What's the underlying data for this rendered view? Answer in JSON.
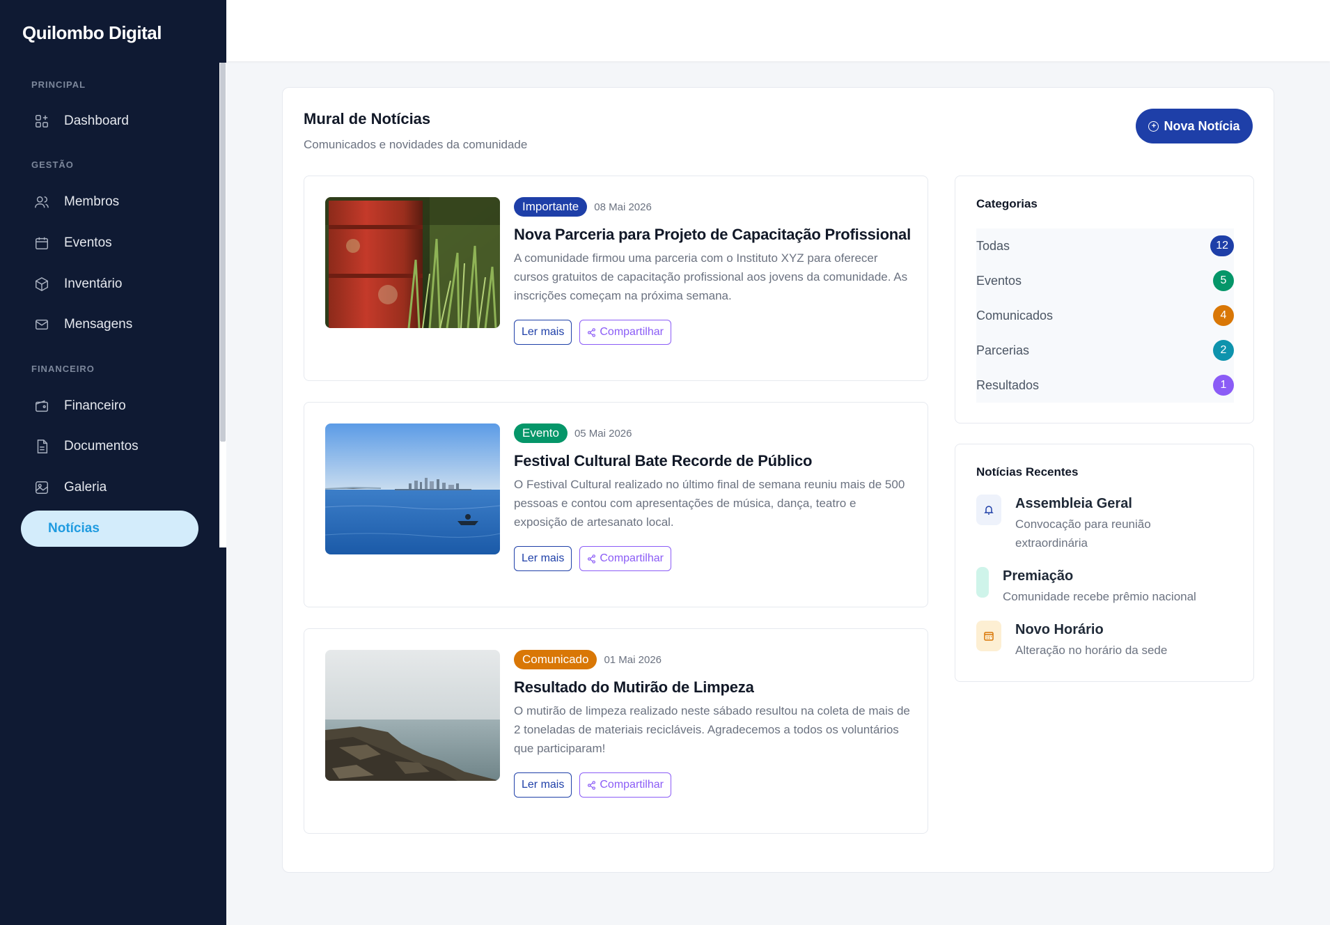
{
  "app": {
    "brand": "Quilombo Digital"
  },
  "sidebar": {
    "sections": [
      {
        "label": "PRINCIPAL"
      },
      {
        "label": "GESTÃO"
      },
      {
        "label": "FINANCEIRO"
      }
    ],
    "items": [
      {
        "label": "Dashboard",
        "icon": "dashboard-icon"
      },
      {
        "label": "Membros",
        "icon": "users-icon"
      },
      {
        "label": "Eventos",
        "icon": "calendar-icon"
      },
      {
        "label": "Inventário",
        "icon": "box-icon"
      },
      {
        "label": "Mensagens",
        "icon": "mail-icon"
      },
      {
        "label": "Financeiro",
        "icon": "wallet-icon"
      },
      {
        "label": "Documentos",
        "icon": "document-icon"
      },
      {
        "label": "Galeria",
        "icon": "gallery-icon"
      },
      {
        "label": "Notícias",
        "icon": "news-icon",
        "active": true
      }
    ]
  },
  "header": {
    "title": "Mural de Notícias",
    "subtitle": "Comunicados e novidades da comunidade",
    "new_button": "Nova Notícia"
  },
  "news": [
    {
      "badge": "Importante",
      "badge_color": "#1e3fa8",
      "date": "08 Mai 2026",
      "title": "Nova Parceria para Projeto de Capacitação Profissional",
      "text": "A comunidade firmou uma parceria com o Instituto XYZ para oferecer cursos gratuitos de capacitação profissional aos jovens da comunidade. As inscrições começam na próxima semana.",
      "read_label": "Ler mais",
      "share_label": "Compartilhar"
    },
    {
      "badge": "Evento",
      "badge_color": "#059669",
      "date": "05 Mai 2026",
      "title": "Festival Cultural Bate Recorde de Público",
      "text": "O Festival Cultural realizado no último final de semana reuniu mais de 500 pessoas e contou com apresentações de música, dança, teatro e exposição de artesanato local.",
      "read_label": "Ler mais",
      "share_label": "Compartilhar"
    },
    {
      "badge": "Comunicado",
      "badge_color": "#d97706",
      "date": "01 Mai 2026",
      "title": "Resultado do Mutirão de Limpeza",
      "text": "O mutirão de limpeza realizado neste sábado resultou na coleta de mais de 2 toneladas de materiais recicláveis. Agradecemos a todos os voluntários que participaram!",
      "read_label": "Ler mais",
      "share_label": "Compartilhar"
    }
  ],
  "categories": {
    "title": "Categorias",
    "items": [
      {
        "label": "Todas",
        "count": "12",
        "color": "#1e3fa8"
      },
      {
        "label": "Eventos",
        "count": "5",
        "color": "#059669"
      },
      {
        "label": "Comunicados",
        "count": "4",
        "color": "#d97706"
      },
      {
        "label": "Parcerias",
        "count": "2",
        "color": "#0e93ad"
      },
      {
        "label": "Resultados",
        "count": "1",
        "color": "#8b5cf6"
      }
    ]
  },
  "recent": {
    "title": "Notícias Recentes",
    "items": [
      {
        "title": "Assembleia Geral",
        "desc": "Convocação para reunião extraordinária",
        "icon": "bell-icon"
      },
      {
        "title": "Premiação",
        "desc": "Comunidade recebe prêmio nacional",
        "icon": "award-icon"
      },
      {
        "title": "Novo Horário",
        "desc": "Alteração no horário da sede",
        "icon": "calendar-icon"
      }
    ]
  }
}
